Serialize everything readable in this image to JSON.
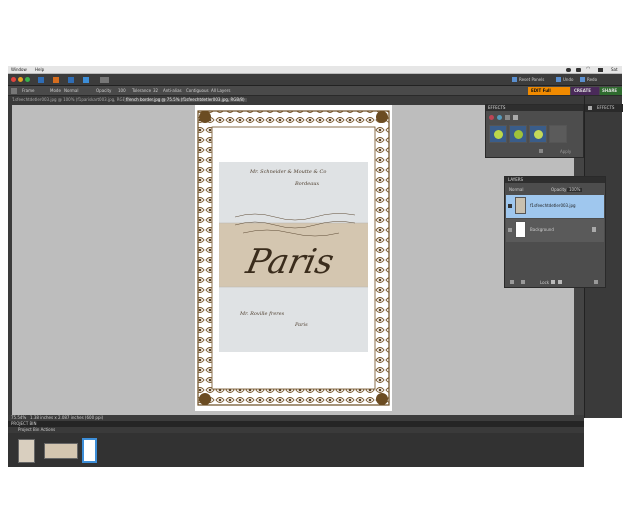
{
  "menubar": {
    "items": [
      "Window",
      "Help"
    ],
    "clock": "Sat"
  },
  "titlebar": {
    "reset_panels": "Reset Panels",
    "undo": "Undo",
    "redo": "Redo"
  },
  "modes": {
    "edit": "EDIT Full",
    "create": "CREATE",
    "share": "SHARE"
  },
  "options_bar": {
    "items": [
      "Frame",
      "Mode",
      "Normal",
      "Opacity",
      "100",
      "Tolerance",
      "32",
      "Anti-alias",
      "Contiguous",
      "All Layers"
    ]
  },
  "doc_tabs": [
    "f1sfeechtdetler003.jpg @ 100% (f1pariskart003.jpg, RGB/8)",
    "french border.jpg @ 75.5% (f1sfeechtdetler003.jpg, RGB/8)"
  ],
  "letter": {
    "line1": "Mr. Schneider & Moutte & Co",
    "line2": "Bordeaux",
    "city": "Paris",
    "footer1": "Mr. Roville freres",
    "footer2": "Paris"
  },
  "effects_panel": {
    "title": "EFFECTS",
    "apply": "Apply"
  },
  "layers_panel": {
    "title": "LAYERS",
    "blend_mode": "Normal",
    "opacity_label": "Opacity",
    "opacity_value": "100%",
    "layers": [
      "f1sfeechtdetler003.jpg",
      "Background"
    ],
    "lock": "Lock"
  },
  "right_strip": {
    "effects_tab": "EFFECTS"
  },
  "status_bar": {
    "zoom": "75.54%",
    "doc_size": "1.38 inches x 2.087 inches (600 ppi)"
  },
  "project_bin": {
    "title": "PROJECT BIN",
    "actions": "Project Bin Actions"
  },
  "colors": {
    "accent_edit": "#f08a00",
    "create": "#4a2a5a",
    "share": "#2f6b2f",
    "selected_layer": "#9fc7ee"
  }
}
